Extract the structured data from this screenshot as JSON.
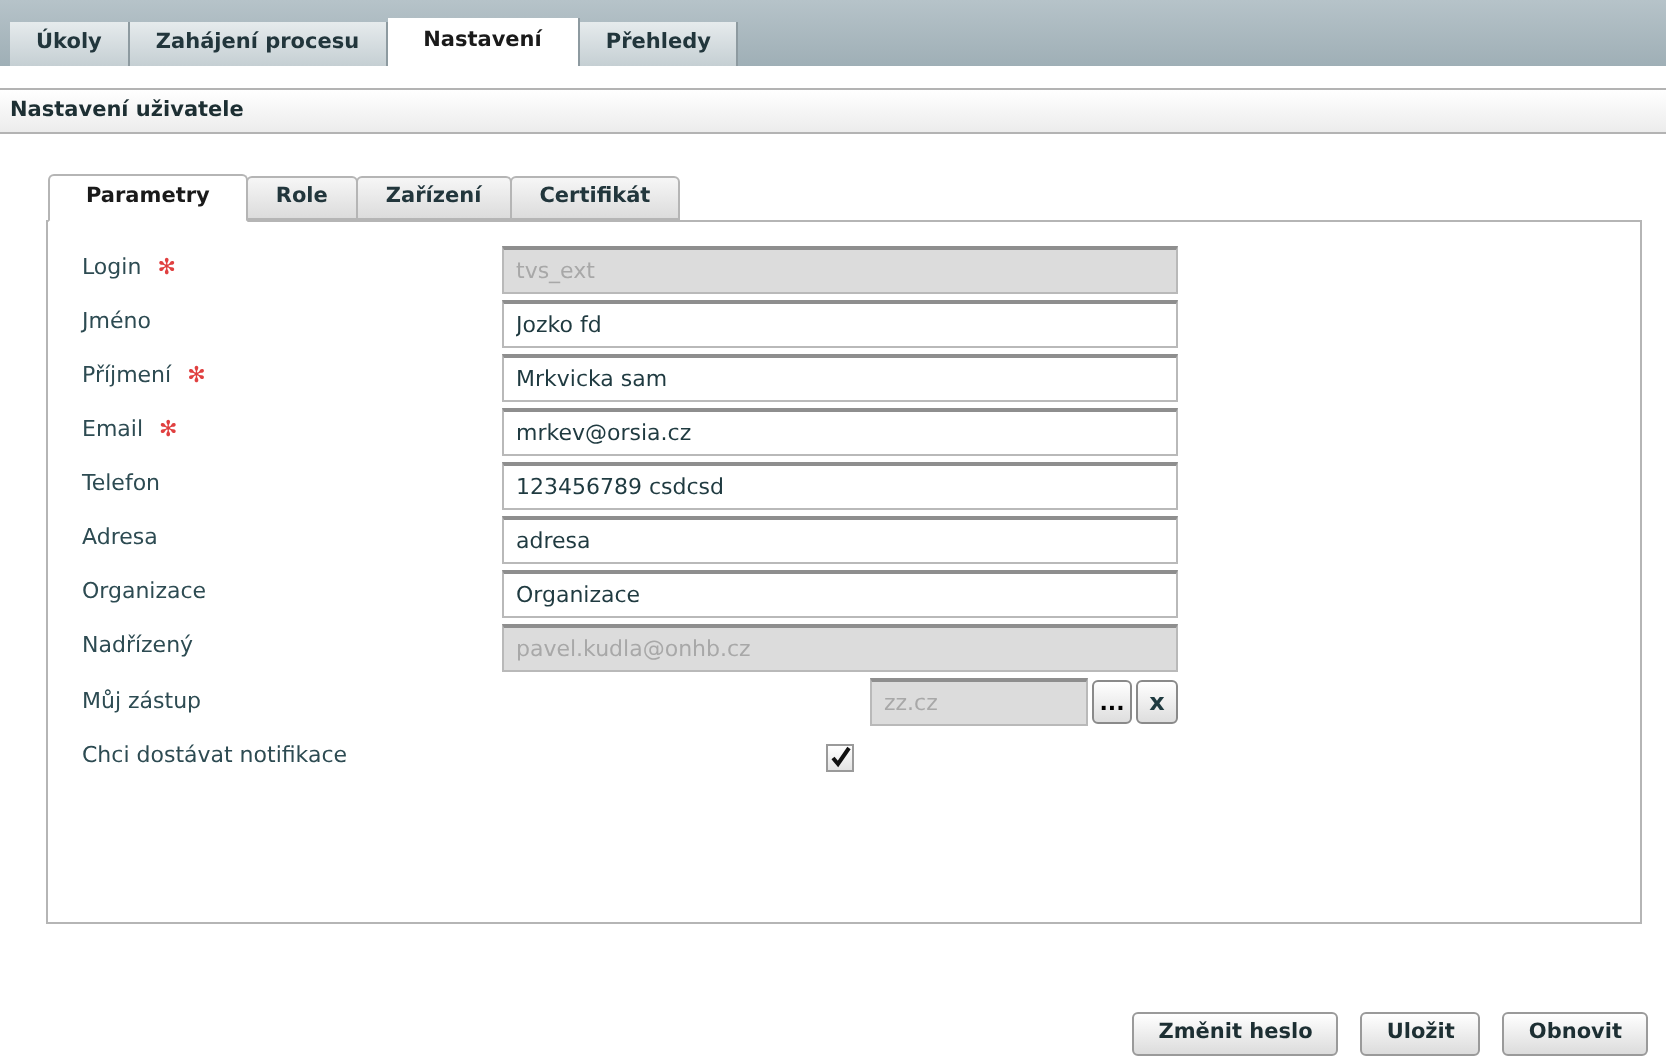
{
  "main_tabs": [
    {
      "label": "Úkoly",
      "selected": false
    },
    {
      "label": "Zahájení procesu",
      "selected": false
    },
    {
      "label": "Nastavení",
      "selected": true
    },
    {
      "label": "Přehledy",
      "selected": false
    }
  ],
  "section_title": "Nastavení uživatele",
  "form_tabs": [
    {
      "label": "Parametry",
      "selected": true
    },
    {
      "label": "Role",
      "selected": false
    },
    {
      "label": "Zařízení",
      "selected": false
    },
    {
      "label": "Certifikát",
      "selected": false
    }
  ],
  "fields": [
    {
      "kind": "text",
      "label": "Login",
      "required_mark": "✻",
      "disabled": true,
      "value": "tvs_ext"
    },
    {
      "kind": "text",
      "label": "Jméno",
      "disabled": false,
      "value": "Jozko fd"
    },
    {
      "kind": "text",
      "label": "Příjmení",
      "required_mark": "✻",
      "disabled": false,
      "value": "Mrkvicka sam"
    },
    {
      "kind": "text",
      "label": "Email",
      "required_mark": "✻",
      "disabled": false,
      "value": "mrkev@orsia.cz"
    },
    {
      "kind": "text",
      "label": "Telefon",
      "disabled": false,
      "value": "123456789 csdcsd"
    },
    {
      "kind": "text",
      "label": "Adresa",
      "disabled": false,
      "value": "adresa"
    },
    {
      "kind": "text",
      "label": "Organizace",
      "disabled": false,
      "value": "Organizace"
    },
    {
      "kind": "text",
      "label": "Nadřízený",
      "disabled": true,
      "value": "pavel.kudla@onhb.cz"
    },
    {
      "kind": "picker",
      "label": "Můj zástup",
      "disabled": true,
      "value": "zz.cz",
      "browse_label": "...",
      "clear_label": "x"
    },
    {
      "kind": "checkbox",
      "label": "Chci dostávat notifikace",
      "checked": true
    }
  ],
  "buttons": [
    "Změnit heslo",
    "Uložit",
    "Obnovit"
  ]
}
